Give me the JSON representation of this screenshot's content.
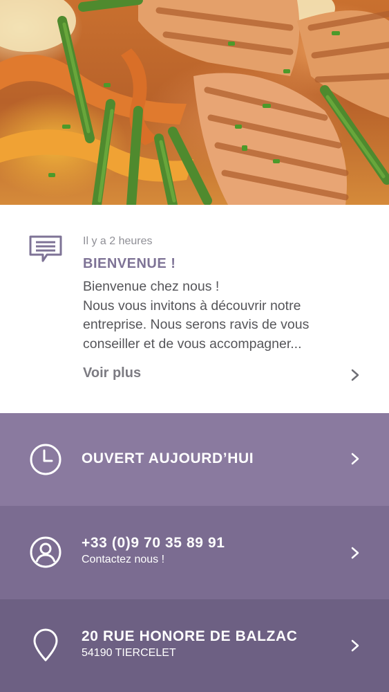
{
  "hero": {
    "image": "grilled-fish-with-vegetables"
  },
  "message": {
    "icon": "chat-message-icon",
    "time": "Il y a 2 heures",
    "title": "BIENVENUE !",
    "lines": [
      "Bienvenue chez nous !",
      "Nous vous invitons à découvrir notre",
      "entreprise. Nous serons ravis de vous",
      "conseiller et de vous accompagner..."
    ],
    "more_label": "Voir plus"
  },
  "rows": {
    "hours": {
      "icon": "clock-icon",
      "title": "OUVERT AUJOURD’HUI"
    },
    "phone": {
      "icon": "user-contact-icon",
      "title": "+33 (0)9 70 35 89 91",
      "subtitle": "Contactez nous !"
    },
    "address": {
      "icon": "location-pin-icon",
      "title": "20 RUE HONORE DE BALZAC",
      "subtitle": "54190 TIERCELET"
    }
  },
  "colors": {
    "accent": "#7e7396",
    "row1": "#8a7a9f",
    "row2": "#7b6c91",
    "row3": "#6d6083"
  }
}
